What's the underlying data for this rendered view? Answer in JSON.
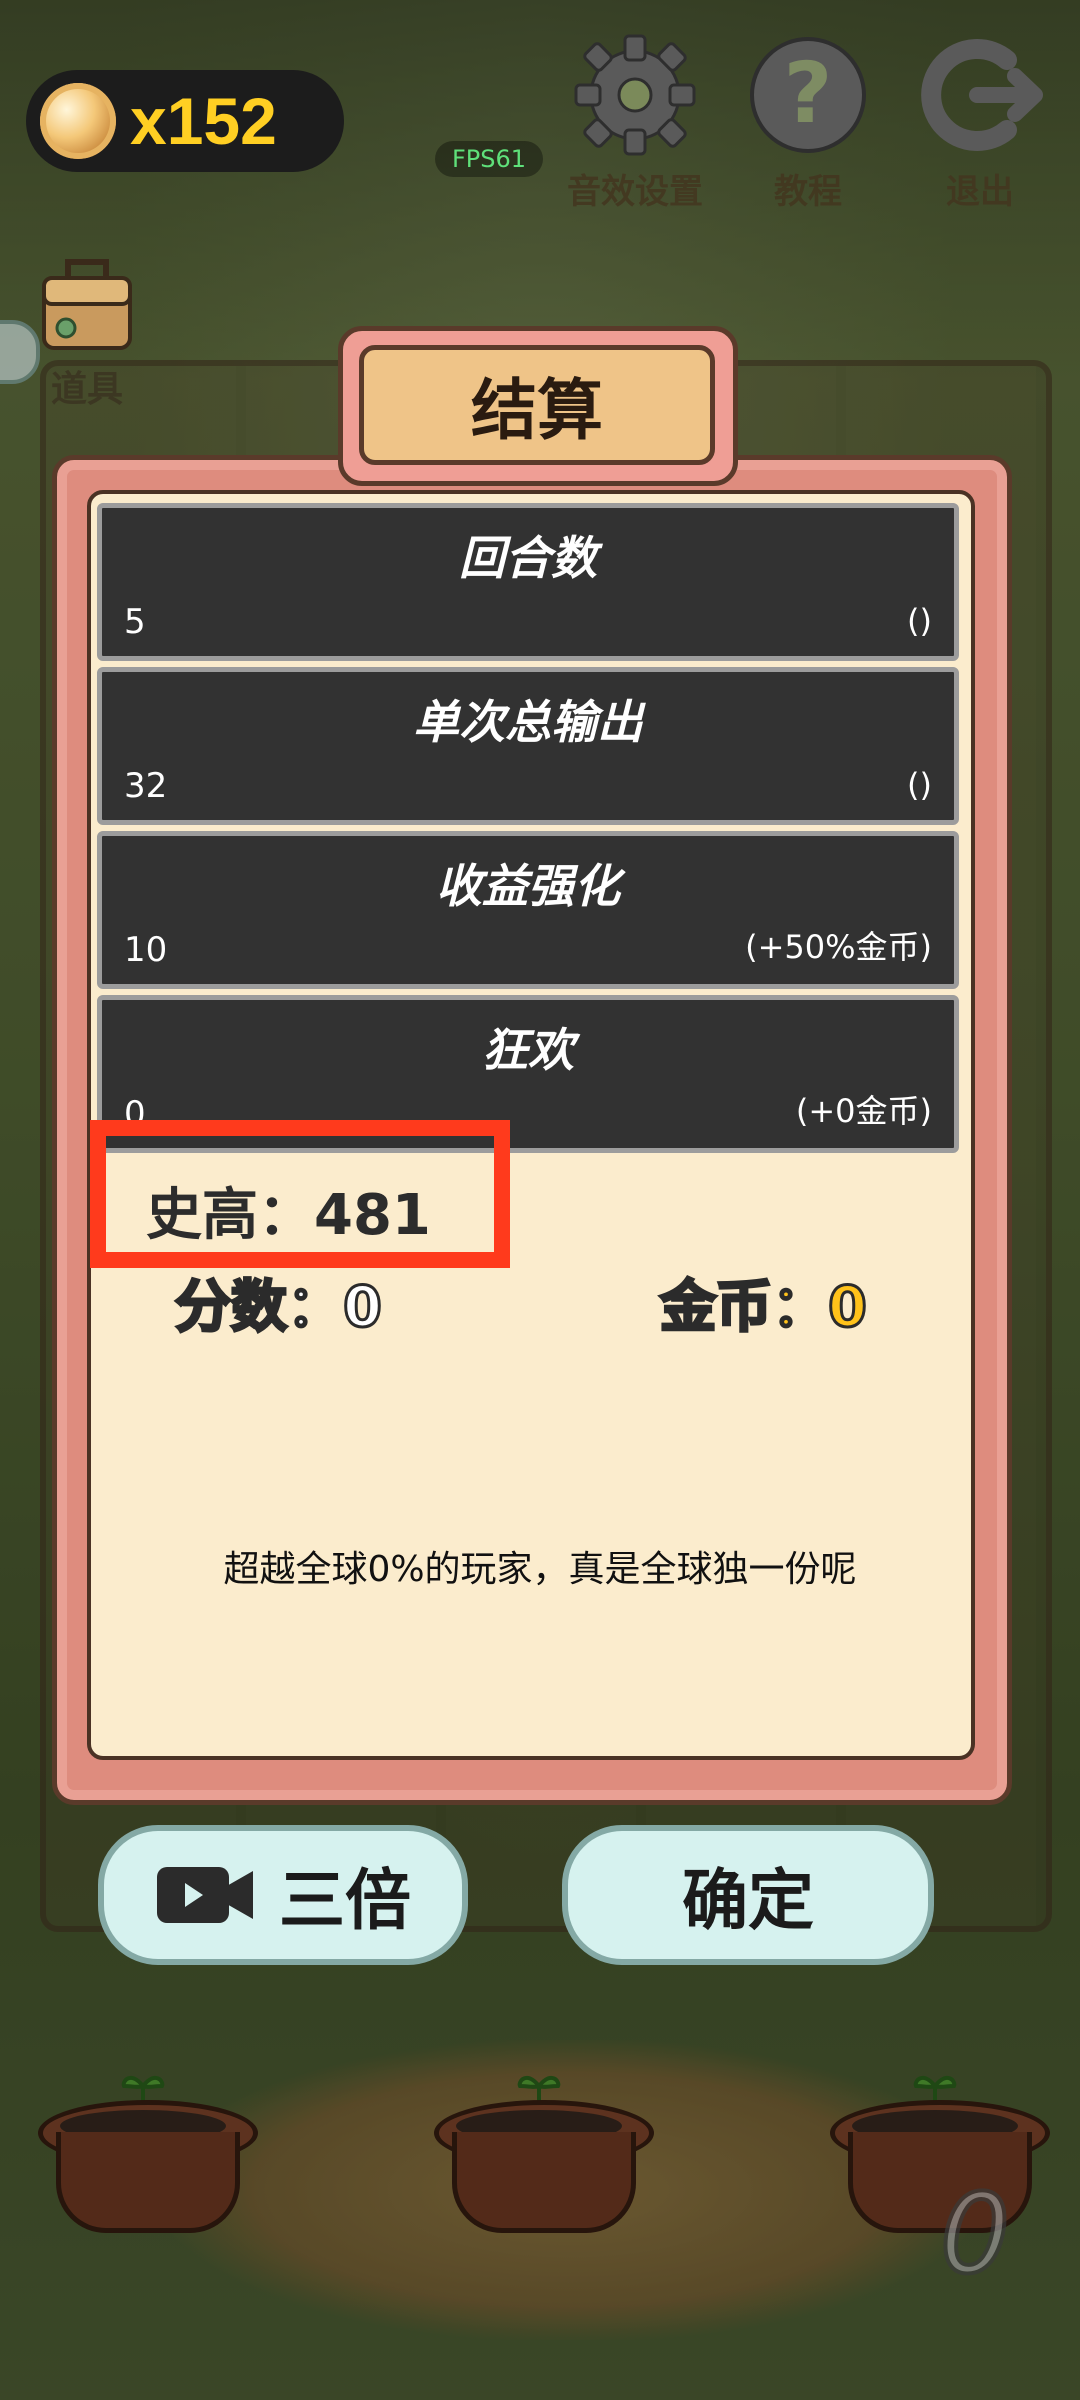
{
  "hud": {
    "coins": "x152",
    "fps": "FPS61",
    "sound_settings": "音效设置",
    "tutorial": "教程",
    "exit": "退出",
    "tools": "道具"
  },
  "result": {
    "title": "结算",
    "rows": [
      {
        "title": "回合数",
        "value": "5",
        "note": "()"
      },
      {
        "title": "单次总输出",
        "value": "32",
        "note": "()"
      },
      {
        "title": "收益强化",
        "value": "10",
        "note": "(+50%金币)"
      },
      {
        "title": "狂欢",
        "value": "0",
        "note": "(+0金币)"
      }
    ],
    "high_score": "史高：481",
    "score": "分数：0",
    "coins": "金币：0",
    "message": "超越全球0%的玩家，真是全球独一份呢"
  },
  "buttons": {
    "triple": "三倍",
    "confirm": "确定"
  },
  "corner_number": "0",
  "colors": {
    "highlight": "#ff3a1c",
    "coin_text": "#ffc21a",
    "fps_text": "#5fe07a"
  }
}
